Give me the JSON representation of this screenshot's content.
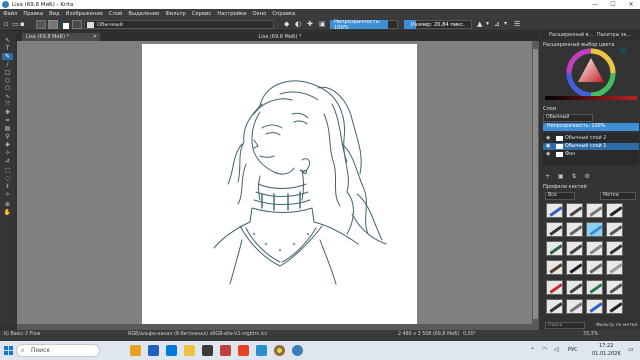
{
  "window": {
    "title": "Lisa (69,8 MиБ) - Krita",
    "buttons": [
      "—",
      "☐",
      "✕"
    ]
  },
  "menu": [
    "Файл",
    "Правка",
    "Вид",
    "Изображение",
    "Слой",
    "Выделение",
    "Фильтр",
    "Сервис",
    "Настройки",
    "Окно",
    "Справка"
  ],
  "toolbar": {
    "blend_mode": "Обычный",
    "opacity_label": "Непрозрачность: 100%",
    "opacity_value": 100,
    "size_label": "Размер: 20,84 пикс.",
    "size_fill": 0.1
  },
  "document": {
    "tab_title": "Lisa (69,8 MиБ) *",
    "canvas_title": "Lisa (69,8 MиБ) *"
  },
  "dockers": {
    "tabs": [
      "Расширенный в...",
      "Палитры эк..."
    ],
    "color_header": "Расширенный выбор цвета",
    "layers_header": "Слои",
    "layers_blend": "Обычный",
    "layers_opacity": "Непрозрачность: 100%",
    "layers": [
      {
        "name": "Обычный слой 2",
        "selected": false
      },
      {
        "name": "Обычный слой 1",
        "selected": true
      },
      {
        "name": "Фон",
        "selected": false
      }
    ],
    "brushes_header": "Профили кистей",
    "brushes_filter": "Все",
    "brushes_tag": "Метка",
    "brushes_search": "Поиск",
    "brushes_filter_tag": "Фильтр по метке"
  },
  "status": {
    "brush": "b) Basic-3 Flow",
    "color_space": "RGB/альфа-канал (8-бит/канал)  sRGB-elle-V2-srgbtrc.icc",
    "dimensions": "2 480 x 3 508 (69,8 MиБ)",
    "angle": "0,00°",
    "zoom": "33,3%"
  },
  "taskbar": {
    "search_placeholder": "Поиск",
    "lang": "РУС",
    "time": "17:22",
    "date": "01.01.2026"
  },
  "colors": {
    "accent": "#3d8fd8",
    "selection": "#2f6ea5",
    "ink": "#1f4a55"
  }
}
